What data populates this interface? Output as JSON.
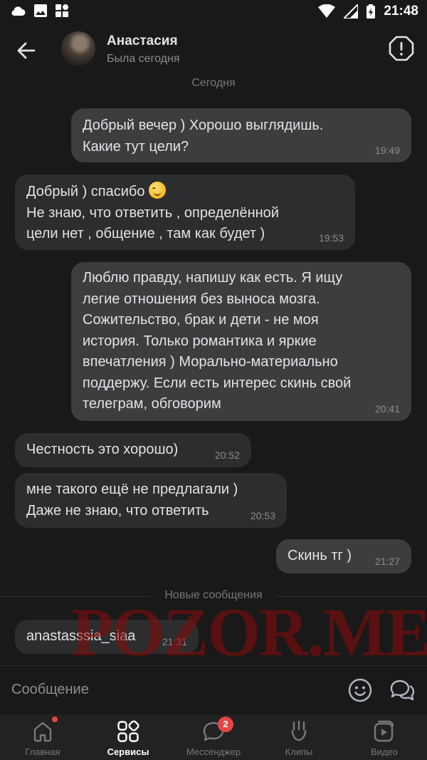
{
  "status_bar": {
    "time": "21:48"
  },
  "header": {
    "contact_name": "Анастасия",
    "contact_status": "Была сегодня"
  },
  "date_separator": "Сегодня",
  "messages": [
    {
      "direction": "out",
      "text": "Добрый вечер ) Хорошо выглядишь.\nКакие тут цели?",
      "time": "19:49"
    },
    {
      "direction": "in",
      "text_line1": "Добрый ) спасибо",
      "text_rest": "Не знаю, что ответить , определённой\nцели нет , общение , там как будет )",
      "time": "19:53"
    },
    {
      "direction": "out",
      "text": "Люблю правду, напишу как есть. Я ищу\nлегие отношения без выноса мозга.\nСожительство, брак и дети - не моя\nистория. Только романтика и яркие\nвпечатления ) Морально-материально\nподдержу. Если есть интерес скинь свой\nтелеграм, обговорим",
      "time": "20:41"
    },
    {
      "direction": "in",
      "text": "Честность это хорошо)",
      "time": "20:52"
    },
    {
      "direction": "in",
      "text": "мне такого ещё не предлагали )\nДаже не знаю, что ответить",
      "time": "20:53"
    },
    {
      "direction": "out",
      "text": "Скинь тг )",
      "time": "21:27"
    },
    {
      "direction": "in",
      "text": "anastasssia_siaa",
      "time": "21:31"
    }
  ],
  "new_messages_separator": "Новые сообщения",
  "watermark": "POZOR.ME",
  "composer": {
    "placeholder": "Сообщение"
  },
  "tabs": [
    {
      "label": "Главная",
      "icon": "home-icon"
    },
    {
      "label": "Сервисы",
      "icon": "services-icon",
      "active": true
    },
    {
      "label": "Мессенджер",
      "icon": "messenger-icon",
      "badge": "2"
    },
    {
      "label": "Клипы",
      "icon": "clips-icon"
    },
    {
      "label": "Видео",
      "icon": "video-icon"
    }
  ],
  "colors": {
    "background": "#191919",
    "bubble_out": "#3d3d3f",
    "bubble_in": "#2c2d2e",
    "badge": "#e64646"
  }
}
